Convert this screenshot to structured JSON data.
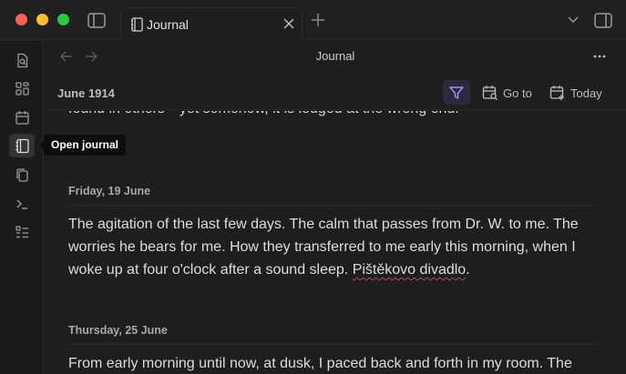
{
  "tab": {
    "label": "Journal"
  },
  "view": {
    "title": "Journal"
  },
  "toolbar": {
    "month": "June 1914",
    "goto_label": "Go to",
    "today_label": "Today"
  },
  "tooltip": {
    "text": "Open journal"
  },
  "content": {
    "cut_line": "found in others—yet somehow, it is lodged at the wrong end.",
    "entries": [
      {
        "date": "Friday, 19 June",
        "text": "The agitation of the last few days. The calm that passes from Dr. W. to me. The worries he bears for me. How they transferred to me early this morning, when I woke up at four o'clock after a sound sleep. ",
        "misspelled": "Pištěkovo divadlo",
        "trailing": "."
      },
      {
        "date": "Thursday, 25 June",
        "text": "From early morning until now, at dusk, I paced back and forth in my room. The"
      }
    ]
  },
  "colors": {
    "accent": "#a68af9",
    "background": "#1e1e1e",
    "ribbon": "#1b1b1b"
  },
  "icons": {
    "ribbon": [
      "search-file-icon",
      "graph-icon",
      "calendar-icon",
      "journal-icon",
      "copy-icon",
      "terminal-icon",
      "list-icon"
    ]
  }
}
